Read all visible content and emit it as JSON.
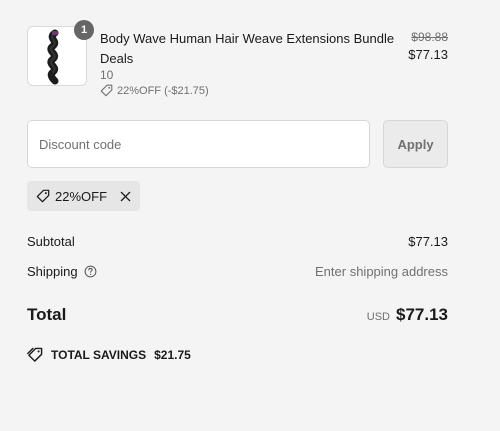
{
  "product": {
    "quantity": "1",
    "title": "Body Wave Human Hair Weave Extensions Bundle Deals",
    "variant": "10",
    "discount_note": "22%OFF (-$21.75)",
    "original_price": "$98.88",
    "price": "$77.13",
    "image": "hair-bundle-thumbnail"
  },
  "discount": {
    "placeholder": "Discount code",
    "value": "",
    "apply_label": "Apply",
    "applied_code": "22%OFF"
  },
  "summary": {
    "subtotal_label": "Subtotal",
    "subtotal_value": "$77.13",
    "shipping_label": "Shipping",
    "shipping_value": "Enter shipping address",
    "total_label": "Total",
    "currency": "USD",
    "total_value": "$77.13",
    "savings_label": "TOTAL SAVINGS",
    "savings_value": "$21.75"
  },
  "icons": {
    "tag": "tag-icon",
    "info": "info-icon",
    "close": "close-icon",
    "savings": "double-tag-icon"
  },
  "colors": {
    "background": "#f4f4f4",
    "text": "#1a1a1a",
    "muted": "#707070",
    "badge": "#666666",
    "chip": "#e6e6e6",
    "button": "#ebebeb"
  }
}
